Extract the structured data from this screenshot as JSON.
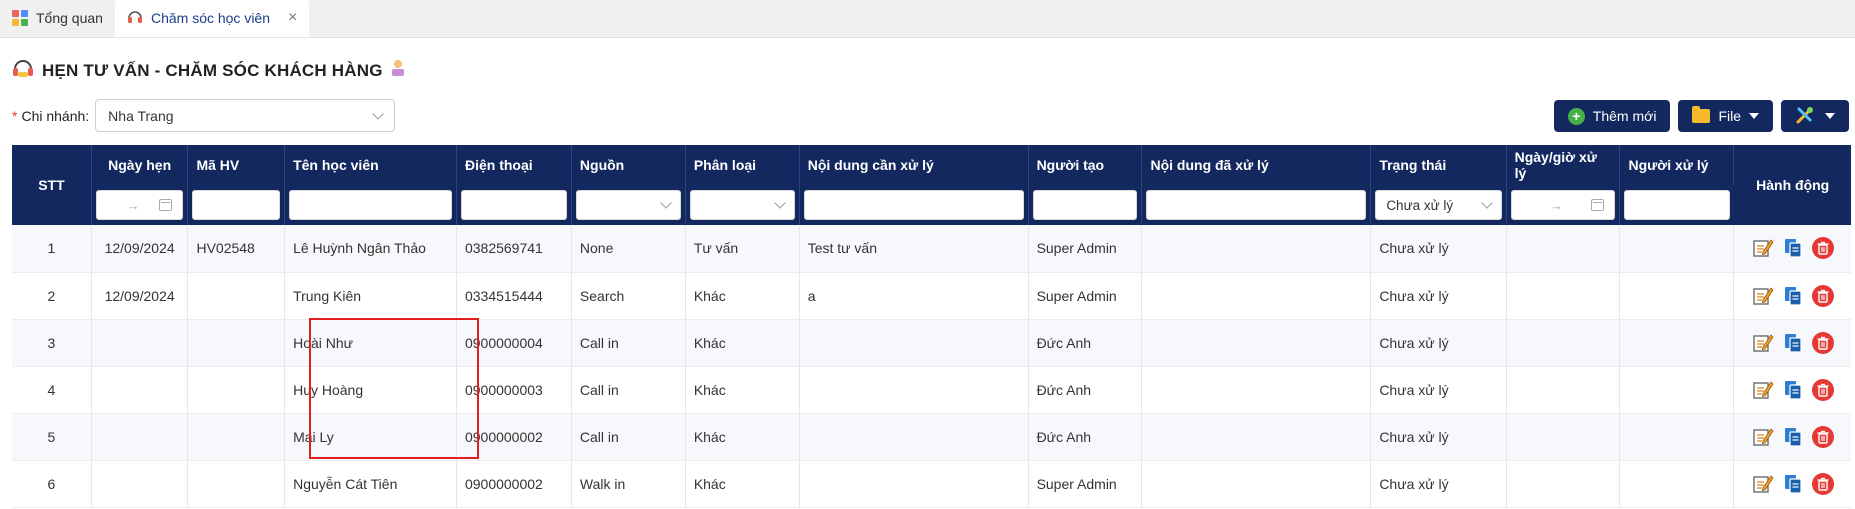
{
  "tabs": [
    {
      "label": "Tổng quan",
      "icon": "grid-icon"
    },
    {
      "label": "Chăm sóc học viên",
      "icon": "headset-icon",
      "active": true
    }
  ],
  "page": {
    "title": "HẸN TƯ VẤN - CHĂM SÓC KHÁCH HÀNG"
  },
  "filters": {
    "branch_label": "Chi nhánh:",
    "branch_value": "Nha Trang"
  },
  "toolbar": {
    "add_label": "Thêm mới",
    "file_label": "File"
  },
  "table": {
    "headers": {
      "stt": "STT",
      "appointment_date": "Ngày hẹn",
      "student_code": "Mã HV",
      "student_name": "Tên học viên",
      "phone": "Điện thoại",
      "source": "Nguồn",
      "category": "Phân loại",
      "content_todo": "Nội dung cần xử lý",
      "creator": "Người tạo",
      "content_done": "Nội dung đã xử lý",
      "status": "Trạng thái",
      "handled_at": "Ngày/giờ xử lý",
      "handler": "Người xử lý",
      "actions": "Hành động"
    },
    "status_filter": "Chưa xử lý",
    "date_range_sep": "→",
    "rows": [
      {
        "stt": "1",
        "date": "12/09/2024",
        "code": "HV02548",
        "name": "Lê Huỳnh Ngân Thảo",
        "phone": "0382569741",
        "source": "None",
        "category": "Tư vấn",
        "todo": "Test tư vấn",
        "creator": "Super Admin",
        "done": "",
        "status": "Chưa xử lý",
        "handled_at": "",
        "handler": ""
      },
      {
        "stt": "2",
        "date": "12/09/2024",
        "code": "",
        "name": "Trung Kiên",
        "phone": "0334515444",
        "source": "Search",
        "category": "Khác",
        "todo": "a",
        "creator": "Super Admin",
        "done": "",
        "status": "Chưa xử lý",
        "handled_at": "",
        "handler": ""
      },
      {
        "stt": "3",
        "date": "",
        "code": "",
        "name": "Hoài Như",
        "phone": "0900000004",
        "source": "Call in",
        "category": "Khác",
        "todo": "",
        "creator": "Đức Anh",
        "done": "",
        "status": "Chưa xử lý",
        "handled_at": "",
        "handler": ""
      },
      {
        "stt": "4",
        "date": "",
        "code": "",
        "name": "Huy Hoàng",
        "phone": "0900000003",
        "source": "Call in",
        "category": "Khác",
        "todo": "",
        "creator": "Đức Anh",
        "done": "",
        "status": "Chưa xử lý",
        "handled_at": "",
        "handler": ""
      },
      {
        "stt": "5",
        "date": "",
        "code": "",
        "name": "Mai Ly",
        "phone": "0900000002",
        "source": "Call in",
        "category": "Khác",
        "todo": "",
        "creator": "Đức Anh",
        "done": "",
        "status": "Chưa xử lý",
        "handled_at": "",
        "handler": ""
      },
      {
        "stt": "6",
        "date": "",
        "code": "",
        "name": "Nguyễn Cát Tiên",
        "phone": "0900000002",
        "source": "Walk in",
        "category": "Khác",
        "todo": "",
        "creator": "Super Admin",
        "done": "",
        "status": "Chưa xử lý",
        "handled_at": "",
        "handler": ""
      }
    ]
  },
  "colors": {
    "header_bg": "#13285f",
    "add_icon": "#43b049",
    "delete_icon": "#e53935",
    "highlight": "#e02020"
  }
}
